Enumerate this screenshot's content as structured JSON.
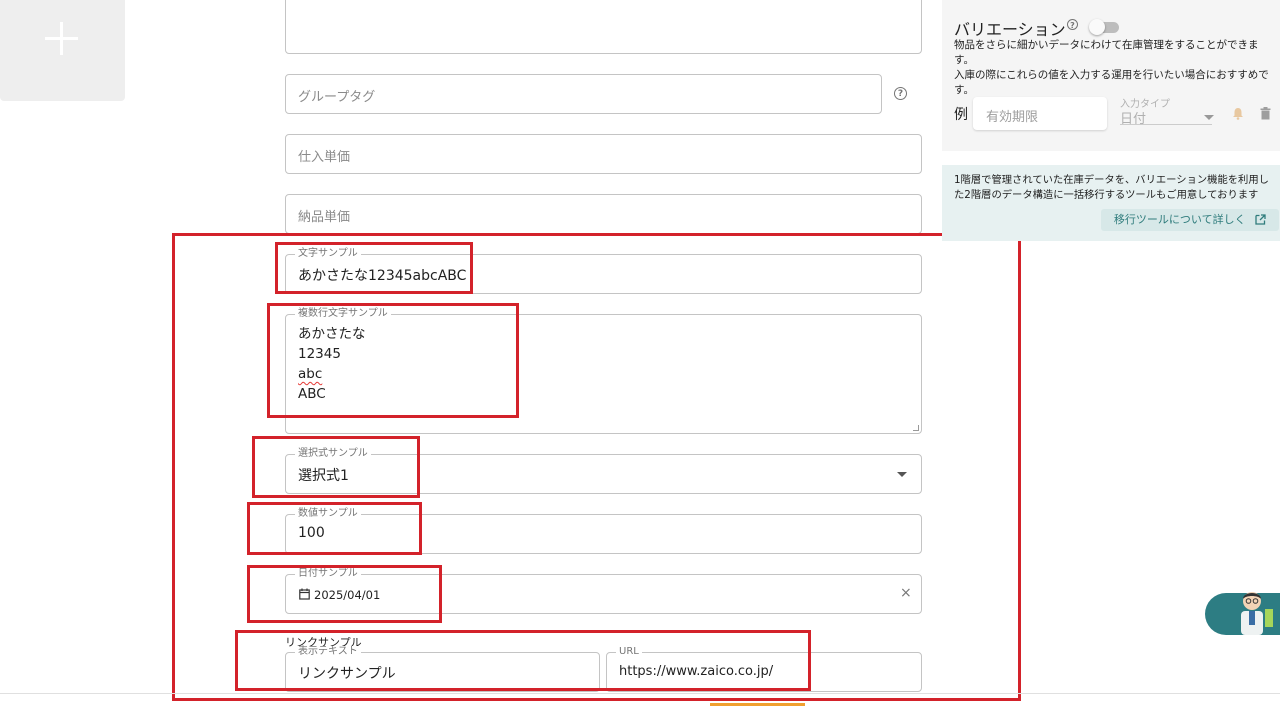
{
  "left": {
    "add_image_icon": "plus-icon"
  },
  "form": {
    "top_textarea_value": "",
    "group_tag_placeholder": "グループタグ",
    "purchase_price_placeholder": "仕入単価",
    "delivery_price_placeholder": "納品単価",
    "text_sample": {
      "label": "文字サンプル",
      "value": "あかさたな12345abcABC"
    },
    "multiline_sample": {
      "label": "複数行文字サンプル",
      "lines": [
        "あかさたな",
        "12345",
        "abc",
        "ABC"
      ]
    },
    "select_sample": {
      "label": "選択式サンプル",
      "value": "選択式1"
    },
    "number_sample": {
      "label": "数値サンプル",
      "value": "100"
    },
    "date_sample": {
      "label": "日付サンプル",
      "value": "2025/04/01",
      "clear": "×"
    },
    "link_sample": {
      "group_label": "リンクサンプル",
      "display_text_label": "表示テキスト",
      "display_text_value": "リンクサンプル",
      "url_label": "URL",
      "url_value": "https://www.zaico.co.jp/"
    }
  },
  "variation": {
    "title": "バリエーション",
    "help": "?",
    "toggle_on": false,
    "desc_lines": [
      "物品をさらに細かいデータにわけて在庫管理をすることができます。",
      "入庫の際にこれらの値を入力する運用を行いたい場合におすすめで",
      "す。"
    ],
    "example_label": "例",
    "example_placeholder": "有効期限",
    "input_type_label": "入力タイプ",
    "input_type_value": "日付"
  },
  "migration": {
    "desc_lines": [
      "1階層で管理されていた在庫データを、バリエーション機能を利用し",
      "た2階層のデータ構造に一括移行するツールもご用意しております"
    ],
    "button_label": "移行ツールについて詳しく"
  },
  "colors": {
    "annotation": "#d3222a",
    "teal": "#2d7d83"
  }
}
